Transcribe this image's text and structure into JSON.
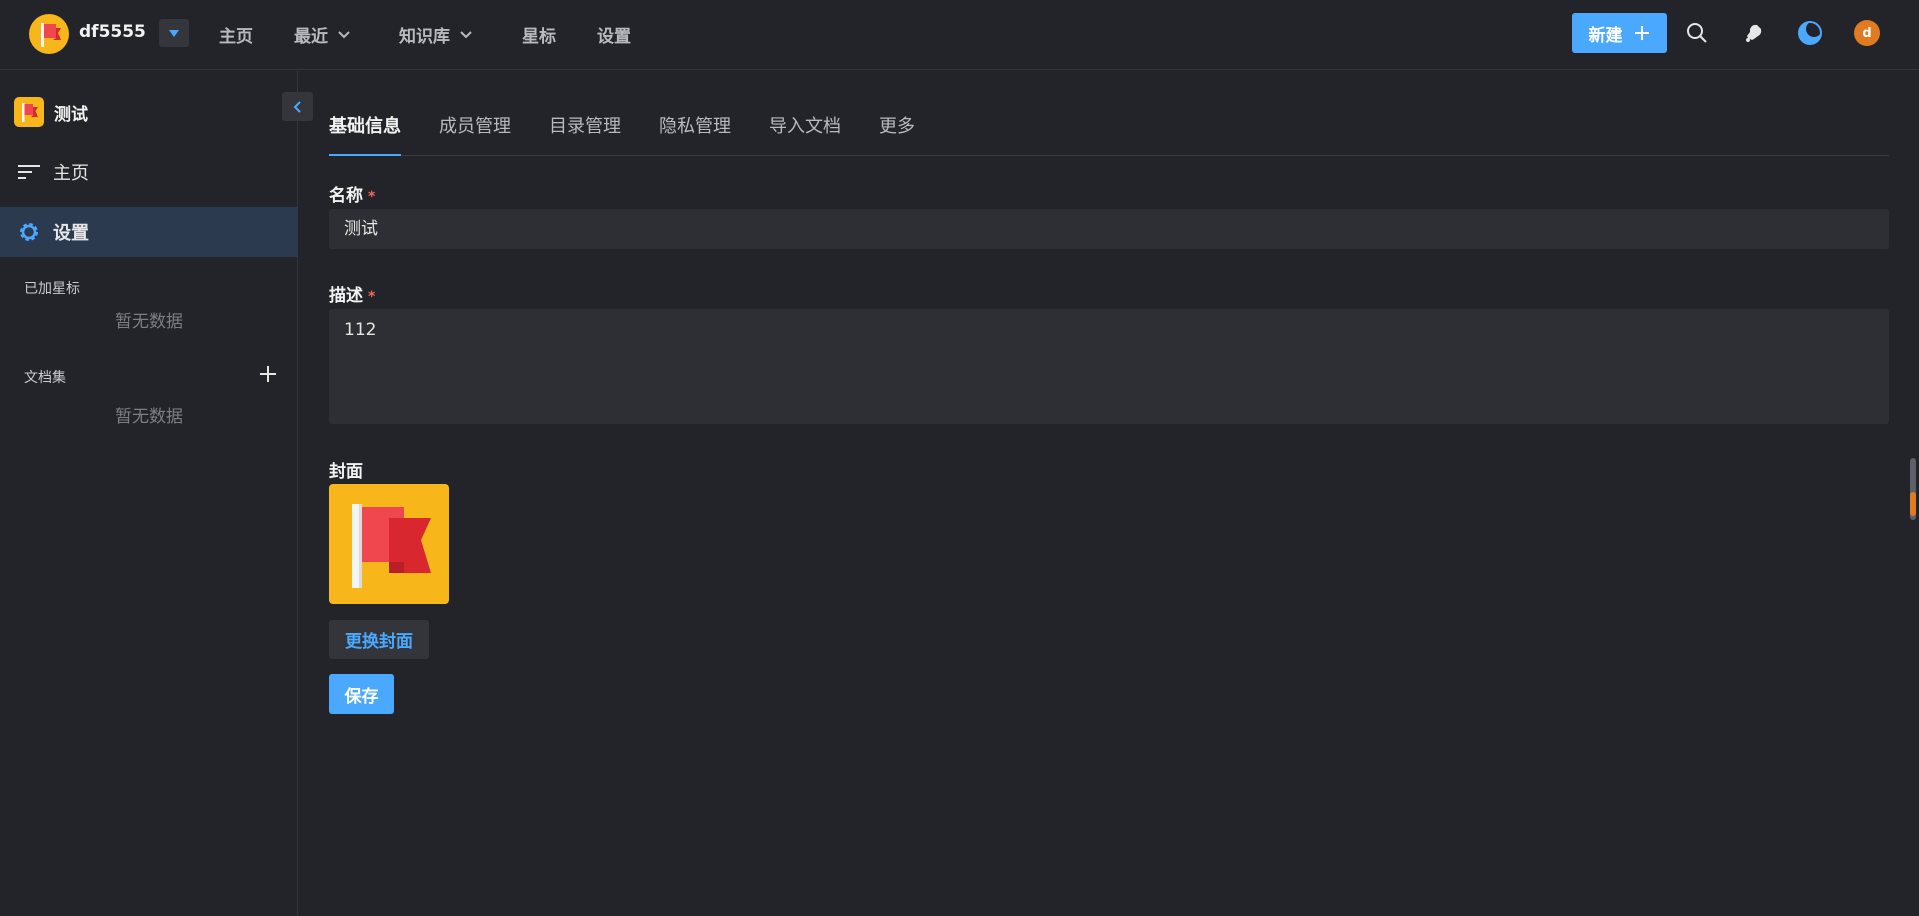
{
  "header": {
    "brand": "df5555",
    "nav": [
      {
        "label": "主页"
      },
      {
        "label": "最近"
      },
      {
        "label": "知识库"
      },
      {
        "label": "星标"
      },
      {
        "label": "设置"
      }
    ],
    "new_button": "新建",
    "avatar_letter": "d"
  },
  "sidebar": {
    "space_name": "测试",
    "items": [
      {
        "label": "主页"
      },
      {
        "label": "设置"
      }
    ],
    "starred_title": "已加星标",
    "starred_empty": "暂无数据",
    "collections_title": "文档集",
    "collections_empty": "暂无数据"
  },
  "main": {
    "tabs": [
      {
        "label": "基础信息"
      },
      {
        "label": "成员管理"
      },
      {
        "label": "目录管理"
      },
      {
        "label": "隐私管理"
      },
      {
        "label": "导入文档"
      },
      {
        "label": "更多"
      }
    ],
    "name_label": "名称",
    "name_required": "*",
    "name_value": "测试",
    "desc_label": "描述",
    "desc_required": "*",
    "desc_value": "112",
    "cover_label": "封面",
    "change_cover_button": "更换封面",
    "save_button": "保存"
  },
  "colors": {
    "accent": "#4aa8ff",
    "background": "#232429",
    "brand_yellow": "#f7b619",
    "flag_red": "#f0474f",
    "required": "#f5675a",
    "avatar": "#e07b22"
  }
}
